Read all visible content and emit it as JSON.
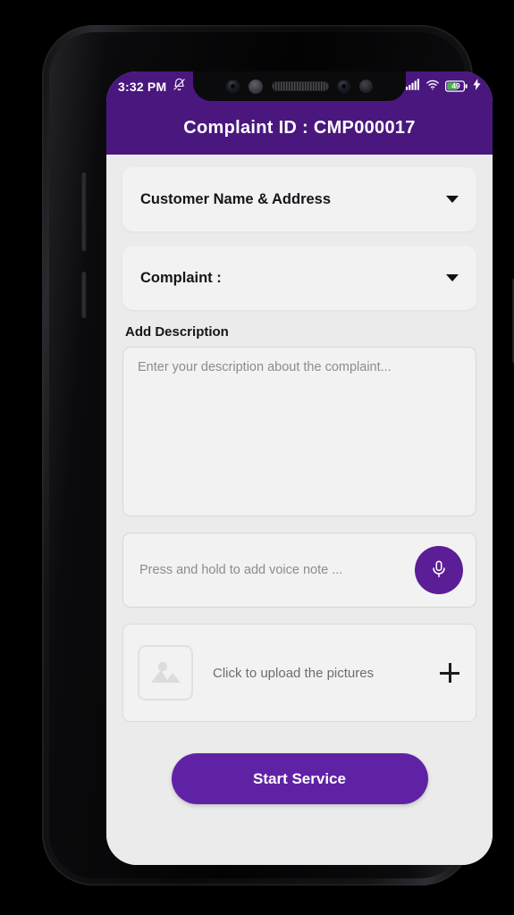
{
  "status_bar": {
    "time": "3:32 PM",
    "battery_percent": "49",
    "icons": {
      "notification_muted": "bell-muted-icon",
      "do_not_disturb": "moon-icon",
      "signal": "signal-bars-icon",
      "wifi": "wifi-icon",
      "battery": "battery-icon",
      "charging": "charging-bolt-icon"
    }
  },
  "app_bar": {
    "title": "Complaint ID : CMP000017"
  },
  "theme": {
    "header_purple": "#4a177e",
    "button_purple": "#6022a5",
    "mic_purple": "#5b1e96",
    "page_background": "#ebebeb",
    "card_background": "#f2f2f2",
    "battery_green": "#4caf50"
  },
  "form": {
    "dropdowns": [
      {
        "label": "Customer Name & Address",
        "expanded": false
      },
      {
        "label": "Complaint :",
        "expanded": false
      }
    ],
    "description": {
      "label": "Add Description",
      "placeholder": "Enter your description about the complaint...",
      "value": ""
    },
    "voice_note": {
      "placeholder": "Press and hold to add voice note ...",
      "value": ""
    },
    "upload": {
      "label": "Click to upload the pictures"
    },
    "submit": {
      "label": "Start Service"
    }
  }
}
